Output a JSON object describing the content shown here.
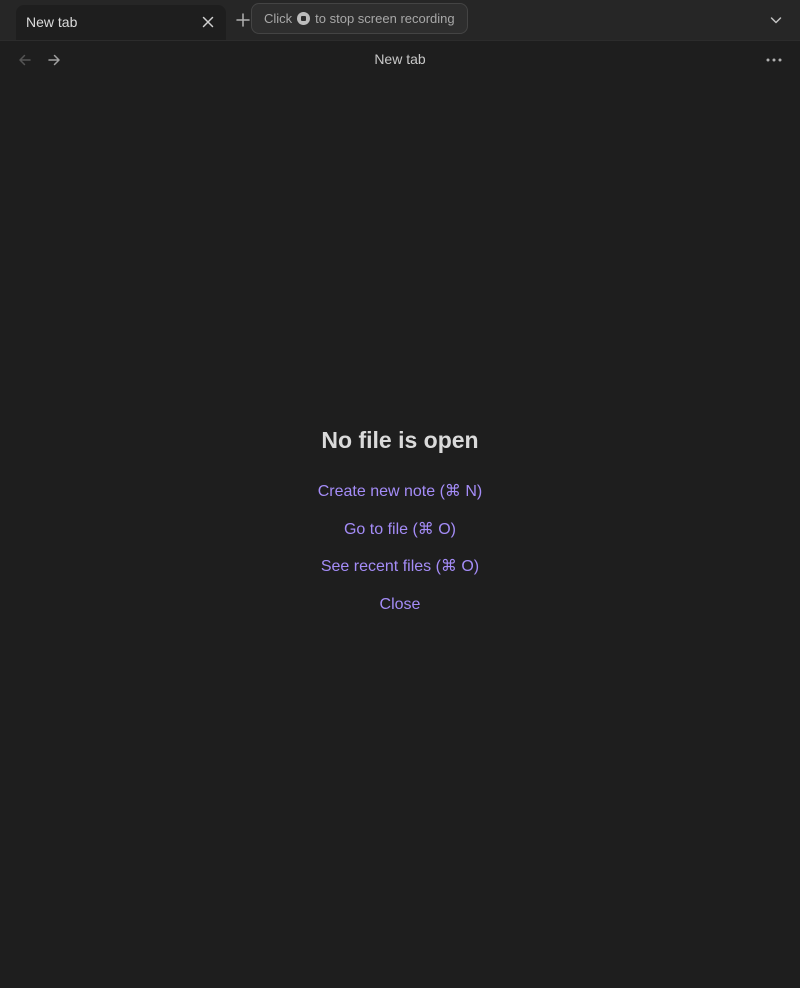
{
  "tabs": [
    {
      "label": "New tab",
      "active": true
    }
  ],
  "recording_banner": {
    "prefix": "Click",
    "suffix": "to stop screen recording"
  },
  "header": {
    "title": "New tab"
  },
  "empty_state": {
    "title": "No file is open",
    "actions": [
      {
        "label": "Create new note (⌘ N)"
      },
      {
        "label": "Go to file (⌘ O)"
      },
      {
        "label": "See recent files (⌘ O)"
      },
      {
        "label": "Close"
      }
    ]
  },
  "icons": {
    "tab_close": "close-icon",
    "new_tab": "plus-icon",
    "tab_list": "chevron-down-icon",
    "back": "arrow-left-icon",
    "forward": "arrow-right-icon",
    "more": "more-horizontal-icon",
    "stop_recording": "stop-record-icon"
  },
  "colors": {
    "background": "#1e1e1e",
    "tab_strip": "#262626",
    "accent_link": "#a48cf7",
    "title_text": "#dadada"
  }
}
